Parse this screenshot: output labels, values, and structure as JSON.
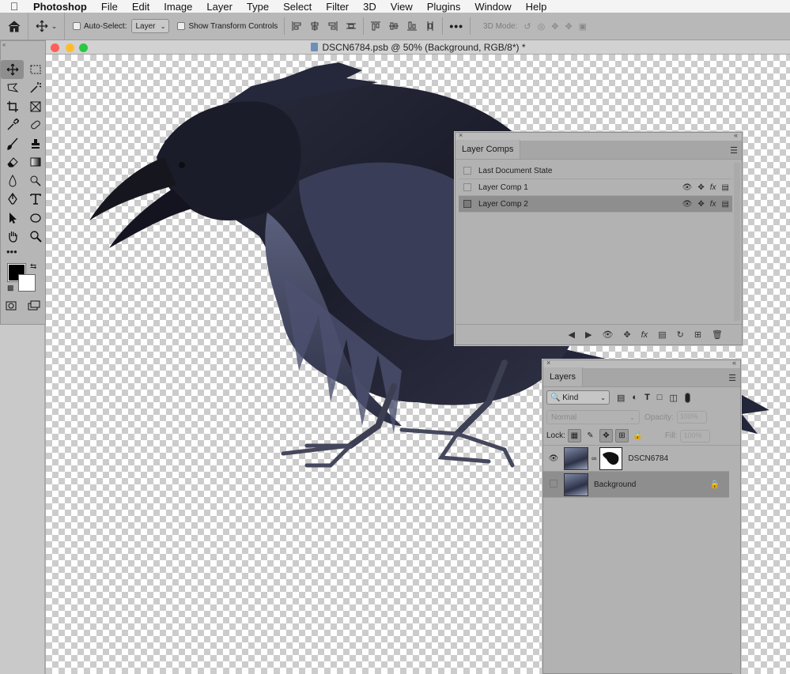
{
  "menubar": {
    "app": "Photoshop",
    "items": [
      "File",
      "Edit",
      "Image",
      "Layer",
      "Type",
      "Select",
      "Filter",
      "3D",
      "View",
      "Plugins",
      "Window",
      "Help"
    ]
  },
  "options": {
    "auto_select_label": "Auto-Select:",
    "auto_select_target": "Layer",
    "show_transform_label": "Show Transform Controls",
    "three_d_mode_label": "3D Mode:"
  },
  "document": {
    "title": "DSCN6784.psb @ 50% (Background, RGB/8*) *"
  },
  "layer_comps": {
    "tab_label": "Layer Comps",
    "rows": [
      {
        "label": "Last Document State",
        "selected": false
      },
      {
        "label": "Layer Comp 1",
        "selected": false
      },
      {
        "label": "Layer Comp 2",
        "selected": true
      }
    ]
  },
  "layers": {
    "tab_label": "Layers",
    "filter_kind": "Kind",
    "blend_mode": "Normal",
    "opacity_label": "Opacity:",
    "opacity_value": "100%",
    "lock_label": "Lock:",
    "fill_label": "Fill:",
    "fill_value": "100%",
    "items": [
      {
        "name": "DSCN6784",
        "visible": true,
        "selected": false
      },
      {
        "name": "Background",
        "visible": false,
        "selected": true
      }
    ]
  },
  "colors": {
    "foreground": "#000000",
    "background": "#ffffff",
    "close": "#fe5f57",
    "minimize": "#febc2e",
    "zoom": "#28c840"
  }
}
